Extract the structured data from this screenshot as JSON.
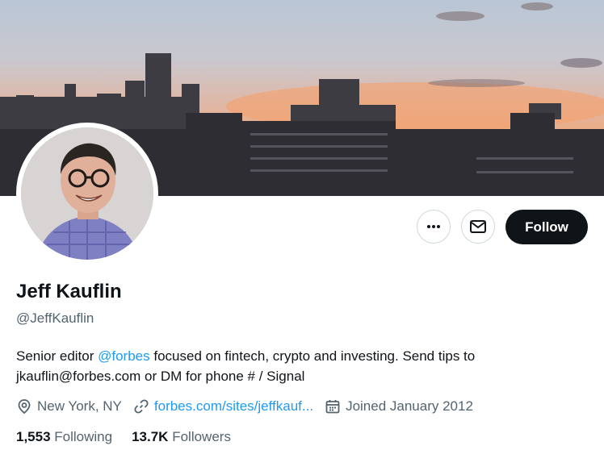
{
  "profile": {
    "name": "Jeff Kauflin",
    "handle": "@JeffKauflin",
    "bio_prefix": "Senior editor ",
    "bio_mention": "@forbes",
    "bio_suffix": " focused on fintech, crypto and investing. Send tips to jkauflin@forbes.com or DM for phone # / Signal",
    "location": "New York, NY",
    "website": "forbes.com/sites/jeffkauf...",
    "joined": "Joined January 2012"
  },
  "stats": {
    "following_count": "1,553",
    "following_label": "Following",
    "followers_count": "13.7K",
    "followers_label": "Followers"
  },
  "actions": {
    "follow_label": "Follow"
  },
  "icons": {
    "more": "more-icon",
    "message": "mail-icon",
    "location": "location-icon",
    "link": "link-icon",
    "calendar": "calendar-icon"
  },
  "colors": {
    "accent": "#1d9bf0",
    "text": "#0f1419",
    "secondary": "#536471",
    "follow_bg": "#0f1419"
  }
}
